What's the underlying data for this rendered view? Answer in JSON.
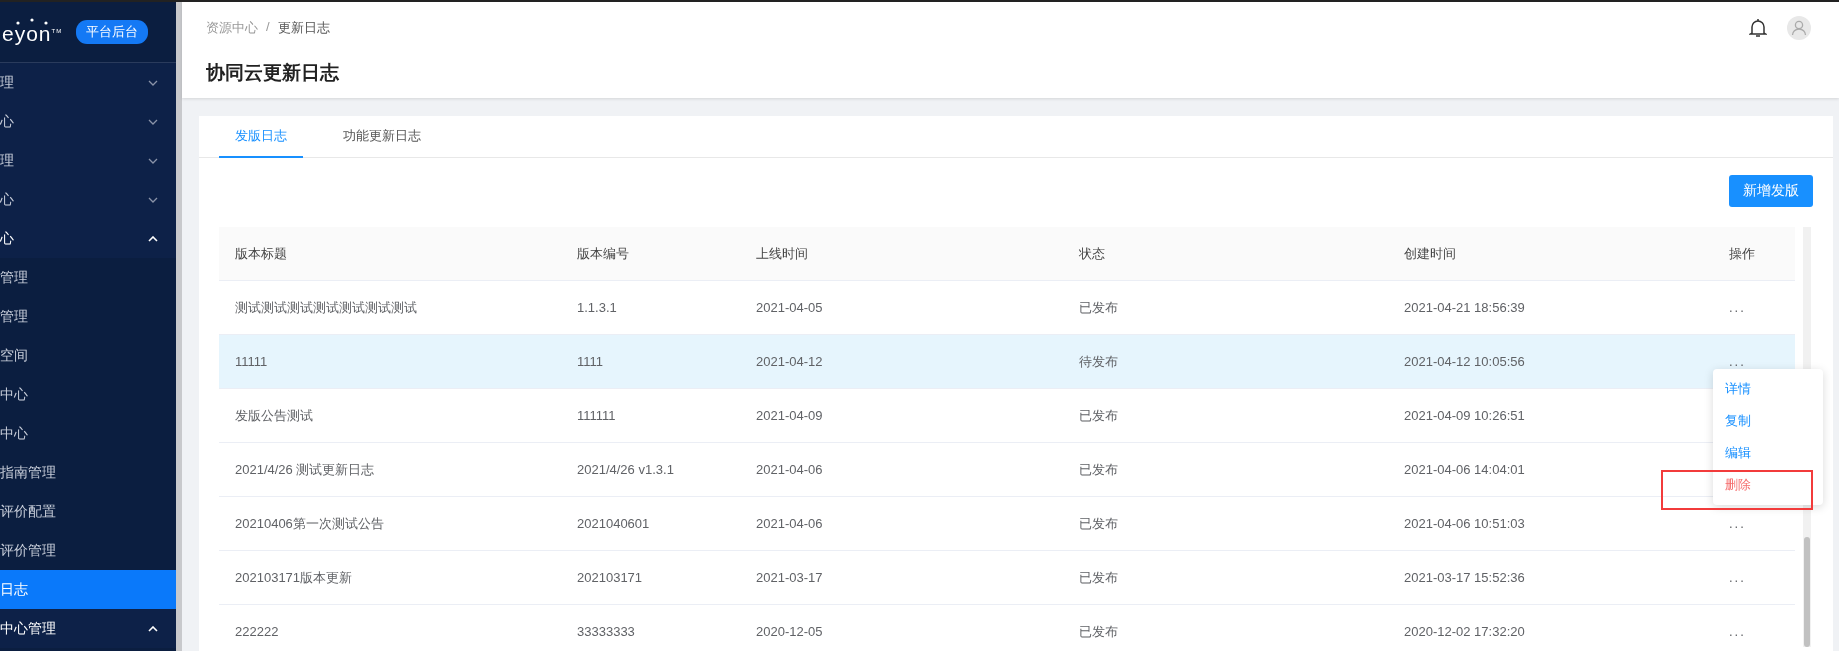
{
  "sidebar": {
    "logo": "eyon",
    "logo_mark": "TM",
    "badge": "平台后台",
    "items": [
      {
        "label": "理",
        "expanded": false
      },
      {
        "label": "心",
        "expanded": false
      },
      {
        "label": "理",
        "expanded": false
      },
      {
        "label": "心",
        "expanded": false
      },
      {
        "label": "心",
        "expanded": true,
        "children": [
          {
            "label": "管理",
            "selected": false
          },
          {
            "label": "管理",
            "selected": false
          },
          {
            "label": "空间",
            "selected": false
          },
          {
            "label": "中心",
            "selected": false
          },
          {
            "label": "中心",
            "selected": false
          },
          {
            "label": "指南管理",
            "selected": false
          },
          {
            "label": "评价配置",
            "selected": false
          },
          {
            "label": "评价管理",
            "selected": false
          },
          {
            "label": "日志",
            "selected": true
          }
        ]
      },
      {
        "label": "中心管理",
        "expanded": true
      }
    ]
  },
  "header": {
    "breadcrumb": [
      "资源中心",
      "更新日志"
    ],
    "separator": "/",
    "title": "协同云更新日志"
  },
  "tabs": [
    {
      "label": "发版日志",
      "selected": true
    },
    {
      "label": "功能更新日志",
      "selected": false
    }
  ],
  "add_button": "新增发版",
  "table": {
    "columns": [
      "版本标题",
      "版本编号",
      "上线时间",
      "状态",
      "创建时间",
      "操作"
    ],
    "rows": [
      {
        "cells": [
          "测试测试测试测试测试测试测试",
          "1.1.3.1",
          "2021-04-05",
          "已发布",
          "2021-04-21 18:56:39"
        ],
        "actions": "...",
        "selected": false
      },
      {
        "cells": [
          "11111",
          "1111",
          "2021-04-12",
          "待发布",
          "2021-04-12 10:05:56"
        ],
        "actions": "...",
        "selected": true
      },
      {
        "cells": [
          "发版公告测试",
          "111111",
          "2021-04-09",
          "已发布",
          "2021-04-09 10:26:51"
        ],
        "selected": false
      },
      {
        "cells": [
          "2021/4/26 测试更新日志",
          "2021/4/26 v1.3.1",
          "2021-04-06",
          "已发布",
          "2021-04-06 14:04:01"
        ],
        "selected": false
      },
      {
        "cells": [
          "20210406第一次测试公告",
          "2021040601",
          "2021-04-06",
          "已发布",
          "2021-04-06 10:51:03"
        ],
        "actions": "...",
        "selected": false
      },
      {
        "cells": [
          "202103171版本更新",
          "202103171",
          "2021-03-17",
          "已发布",
          "2021-03-17 15:52:36"
        ],
        "actions": "...",
        "selected": false
      },
      {
        "cells": [
          "222222",
          "33333333",
          "2020-12-05",
          "已发布",
          "2020-12-02 17:32:20"
        ],
        "actions": "...",
        "selected": false
      }
    ]
  },
  "action_menu": [
    {
      "label": "详情",
      "kind": "normal",
      "highlighted": false
    },
    {
      "label": "复制",
      "kind": "normal",
      "highlighted": false
    },
    {
      "label": "编辑",
      "kind": "normal",
      "highlighted": false
    },
    {
      "label": "删除",
      "kind": "danger",
      "highlighted": true
    }
  ]
}
